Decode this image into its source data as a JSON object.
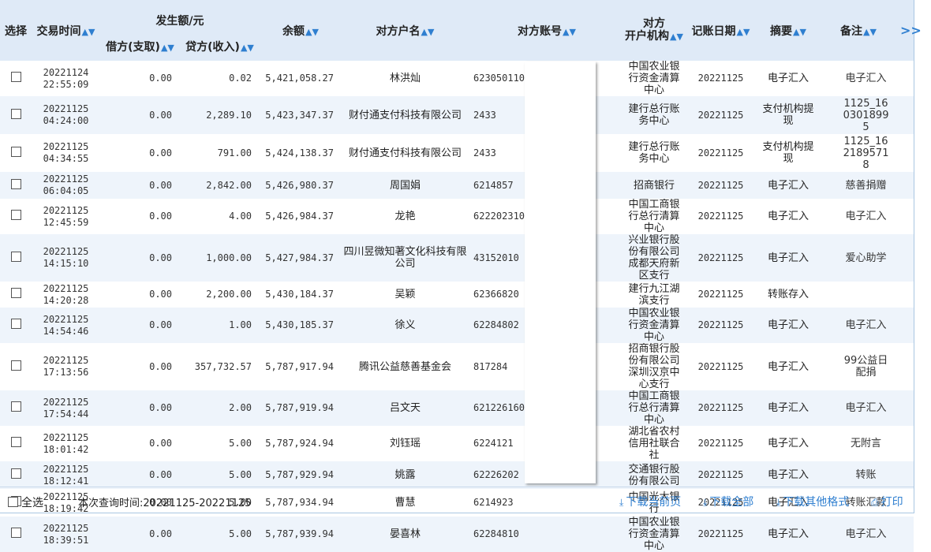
{
  "headers": {
    "select": "选择",
    "time": "交易时间",
    "amount_group": "发生额/元",
    "debit": "借方(支取)",
    "credit": "贷方(收入)",
    "balance": "余额",
    "payee_name": "对方户名",
    "payee_account": "对方账号",
    "payee_bank_l1": "对方",
    "payee_bank_l2": "开户机构",
    "post_date": "记账日期",
    "summary": "摘要",
    "remark": "备注",
    "next": ">>"
  },
  "rows": [
    {
      "date": "20221124",
      "time": "22:55:09",
      "debit": "0.00",
      "credit": "0.02",
      "balance": "5,421,058.27",
      "name": "林洪灿",
      "account": "623050110",
      "bank": "中国农业银行资金清算中心",
      "post_date": "20221125",
      "summary": "电子汇入",
      "remark": "电子汇入"
    },
    {
      "date": "20221125",
      "time": "04:24:00",
      "debit": "0.00",
      "credit": "2,289.10",
      "balance": "5,423,347.37",
      "name": "财付通支付科技有限公司",
      "account": "2433",
      "bank": "建行总行账务中心",
      "post_date": "20221125",
      "summary": "支付机构提现",
      "remark": "1125_1603018995"
    },
    {
      "date": "20221125",
      "time": "04:34:55",
      "debit": "0.00",
      "credit": "791.00",
      "balance": "5,424,138.37",
      "name": "财付通支付科技有限公司",
      "account": "2433",
      "bank": "建行总行账务中心",
      "post_date": "20221125",
      "summary": "支付机构提现",
      "remark": "1125_1621895718"
    },
    {
      "date": "20221125",
      "time": "06:04:05",
      "debit": "0.00",
      "credit": "2,842.00",
      "balance": "5,426,980.37",
      "name": "周国娟",
      "account": "6214857",
      "bank": "招商银行",
      "post_date": "20221125",
      "summary": "电子汇入",
      "remark": "慈善捐赠"
    },
    {
      "date": "20221125",
      "time": "12:45:59",
      "debit": "0.00",
      "credit": "4.00",
      "balance": "5,426,984.37",
      "name": "龙艳",
      "account": "622202310",
      "bank": "中国工商银行总行清算中心",
      "post_date": "20221125",
      "summary": "电子汇入",
      "remark": "电子汇入"
    },
    {
      "date": "20221125",
      "time": "14:15:10",
      "debit": "0.00",
      "credit": "1,000.00",
      "balance": "5,427,984.37",
      "name": "四川昱微知著文化科技有限公司",
      "account": "43152010",
      "bank": "兴业银行股份有限公司成都天府新区支行",
      "post_date": "20221125",
      "summary": "电子汇入",
      "remark": "爱心助学"
    },
    {
      "date": "20221125",
      "time": "14:20:28",
      "debit": "0.00",
      "credit": "2,200.00",
      "balance": "5,430,184.37",
      "name": "吴颖",
      "account": "62366820",
      "bank": "建行九江湖滨支行",
      "post_date": "20221125",
      "summary": "转账存入",
      "remark": ""
    },
    {
      "date": "20221125",
      "time": "14:54:46",
      "debit": "0.00",
      "credit": "1.00",
      "balance": "5,430,185.37",
      "name": "徐义",
      "account": "62284802",
      "bank": "中国农业银行资金清算中心",
      "post_date": "20221125",
      "summary": "电子汇入",
      "remark": "电子汇入"
    },
    {
      "date": "20221125",
      "time": "17:13:56",
      "debit": "0.00",
      "credit": "357,732.57",
      "balance": "5,787,917.94",
      "name": "腾讯公益慈善基金会",
      "account": "817284",
      "bank": "招商银行股份有限公司深圳汉京中心支行",
      "post_date": "20221125",
      "summary": "电子汇入",
      "remark": "99公益日配捐"
    },
    {
      "date": "20221125",
      "time": "17:54:44",
      "debit": "0.00",
      "credit": "2.00",
      "balance": "5,787,919.94",
      "name": "吕文天",
      "account": "621226160",
      "bank": "中国工商银行总行清算中心",
      "post_date": "20221125",
      "summary": "电子汇入",
      "remark": "电子汇入"
    },
    {
      "date": "20221125",
      "time": "18:01:42",
      "debit": "0.00",
      "credit": "5.00",
      "balance": "5,787,924.94",
      "name": "刘钰瑶",
      "account": "6224121",
      "bank": "湖北省农村信用社联合社",
      "post_date": "20221125",
      "summary": "电子汇入",
      "remark": "无附言"
    },
    {
      "date": "20221125",
      "time": "18:12:41",
      "debit": "0.00",
      "credit": "5.00",
      "balance": "5,787,929.94",
      "name": "姚露",
      "account": "62226202",
      "bank": "交通银行股份有限公司",
      "post_date": "20221125",
      "summary": "电子汇入",
      "remark": "转账"
    },
    {
      "date": "20221125",
      "time": "18:19:42",
      "debit": "0.00",
      "credit": "5.00",
      "balance": "5,787,934.94",
      "name": "曹慧",
      "account": "6214923",
      "bank": "中国光大银行",
      "post_date": "20221125",
      "summary": "电子汇入",
      "remark": "转账汇款"
    },
    {
      "date": "20221125",
      "time": "18:39:51",
      "debit": "0.00",
      "credit": "5.00",
      "balance": "5,787,939.94",
      "name": "晏喜林",
      "account": "62284810",
      "bank": "中国农业银行资金清算中心",
      "post_date": "20221125",
      "summary": "电子汇入",
      "remark": "电子汇入"
    }
  ],
  "footer": {
    "select_all": "全选",
    "query_time": "本次查询时间:20221125-20221125",
    "download_page": "下载当前页",
    "download_all": "下载全部",
    "download_other": "下载其他格式",
    "print": "打印"
  }
}
